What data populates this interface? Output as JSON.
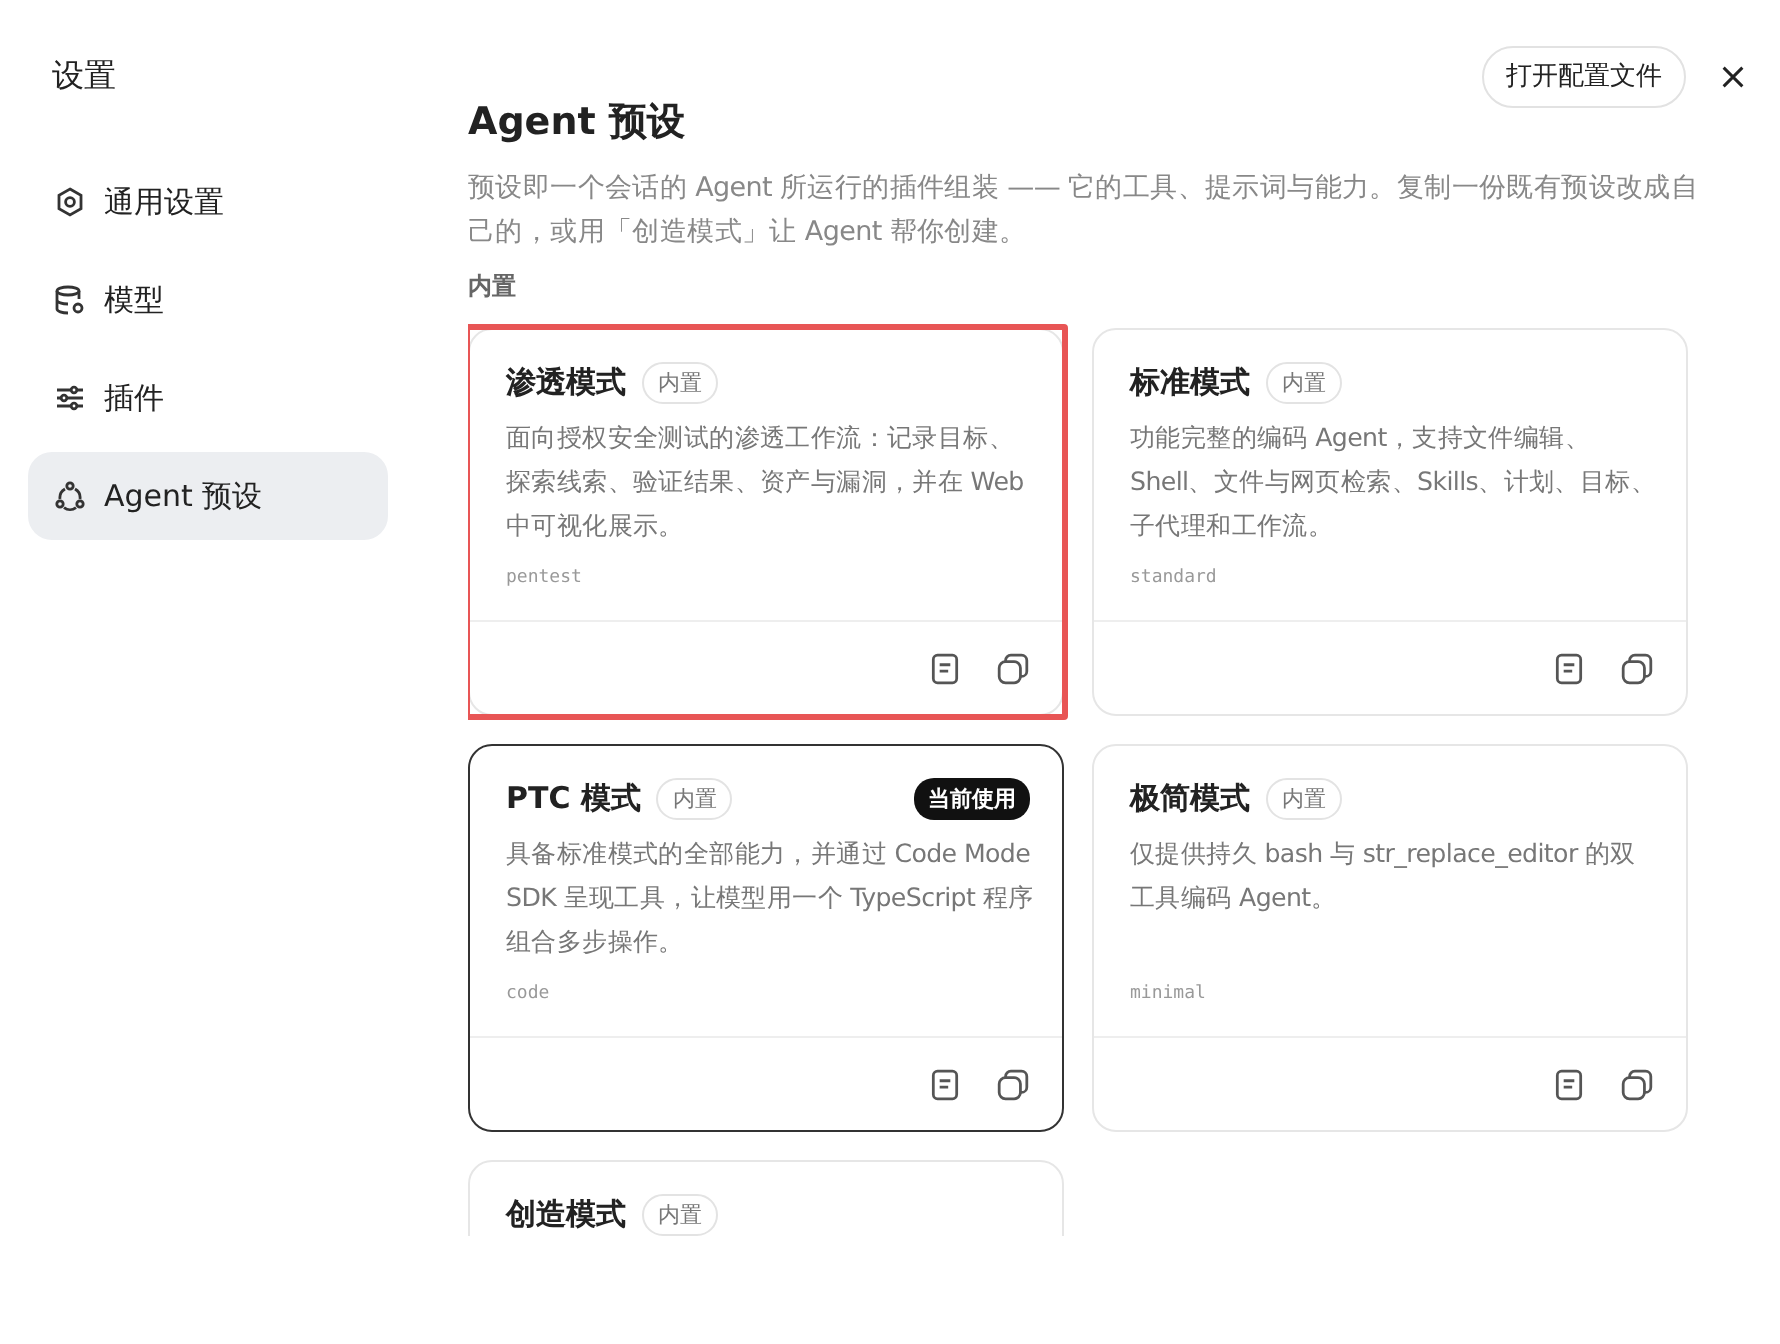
{
  "sidebar": {
    "title": "设置",
    "items": [
      {
        "label": "通用设置",
        "selected": false
      },
      {
        "label": "模型",
        "selected": false
      },
      {
        "label": "插件",
        "selected": false
      },
      {
        "label": "Agent 预设",
        "selected": true
      }
    ]
  },
  "header": {
    "open_config_button": "打开配置文件"
  },
  "page": {
    "title": "Agent 预设",
    "description": "预设即一个会话的 Agent 所运行的插件组装 —— 它的工具、提示词与能力。复制一份既有预设改成自己的，或用「创造模式」让 Agent 帮你创建。",
    "section_label": "内置"
  },
  "presets": [
    {
      "name": "渗透模式",
      "tag": "内置",
      "description": "面向授权安全测试的渗透工作流：记录目标、探索线索、验证结果、资产与漏洞，并在 Web 中可视化展示。",
      "id_label": "pentest",
      "selected": false,
      "highlighted": true
    },
    {
      "name": "标准模式",
      "tag": "内置",
      "description": "功能完整的编码 Agent，支持文件编辑、Shell、文件与网页检索、Skills、计划、目标、子代理和工作流。",
      "id_label": "standard",
      "selected": false,
      "highlighted": false
    },
    {
      "name": "PTC 模式",
      "tag": "内置",
      "badge": "当前使用",
      "description": "具备标准模式的全部能力，并通过 Code Mode SDK 呈现工具，让模型用一个 TypeScript 程序组合多步操作。",
      "id_label": "code",
      "selected": true,
      "highlighted": false
    },
    {
      "name": "极简模式",
      "tag": "内置",
      "description": "仅提供持久 bash 与 str_replace_editor 的双工具编码 Agent。",
      "id_label": "minimal",
      "selected": false,
      "highlighted": false
    },
    {
      "name": "创造模式",
      "tag": "内置",
      "selected": false,
      "highlighted": false
    }
  ]
}
